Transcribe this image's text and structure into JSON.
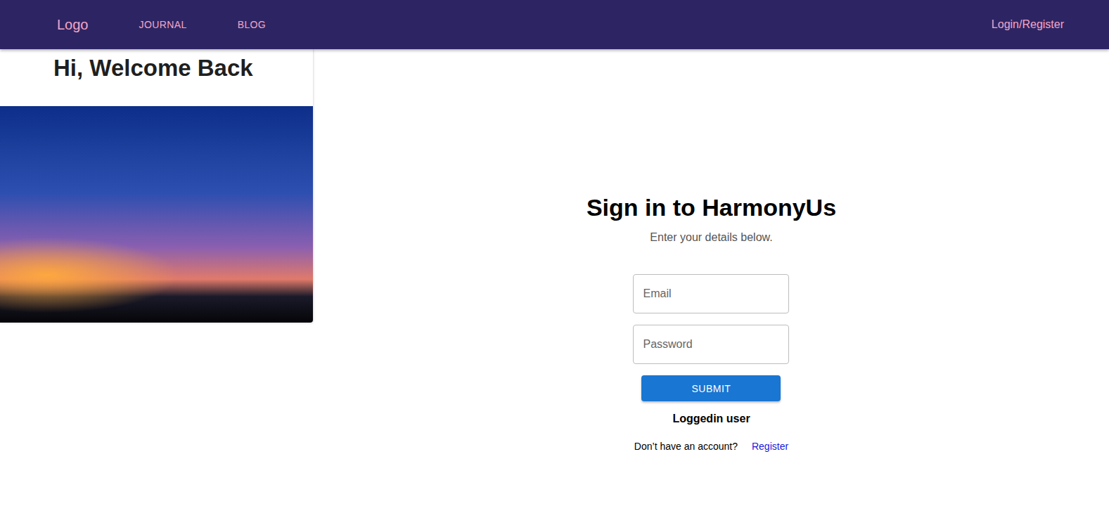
{
  "nav": {
    "logo": "Logo",
    "links": [
      {
        "label": "JOURNAL"
      },
      {
        "label": "BLOG"
      }
    ],
    "account": "Login/Register"
  },
  "side": {
    "greeting": "Hi, Welcome Back"
  },
  "form": {
    "title": "Sign in to HarmonyUs",
    "subtitle": "Enter your details below.",
    "fields": [
      {
        "name": "email",
        "placeholder": "Email",
        "type": "email"
      },
      {
        "name": "password",
        "placeholder": "Password",
        "type": "password"
      }
    ],
    "submit": "SUBMIT",
    "status": "Loggedin user",
    "prompt": "Don’t have an account?",
    "link": "Register"
  }
}
